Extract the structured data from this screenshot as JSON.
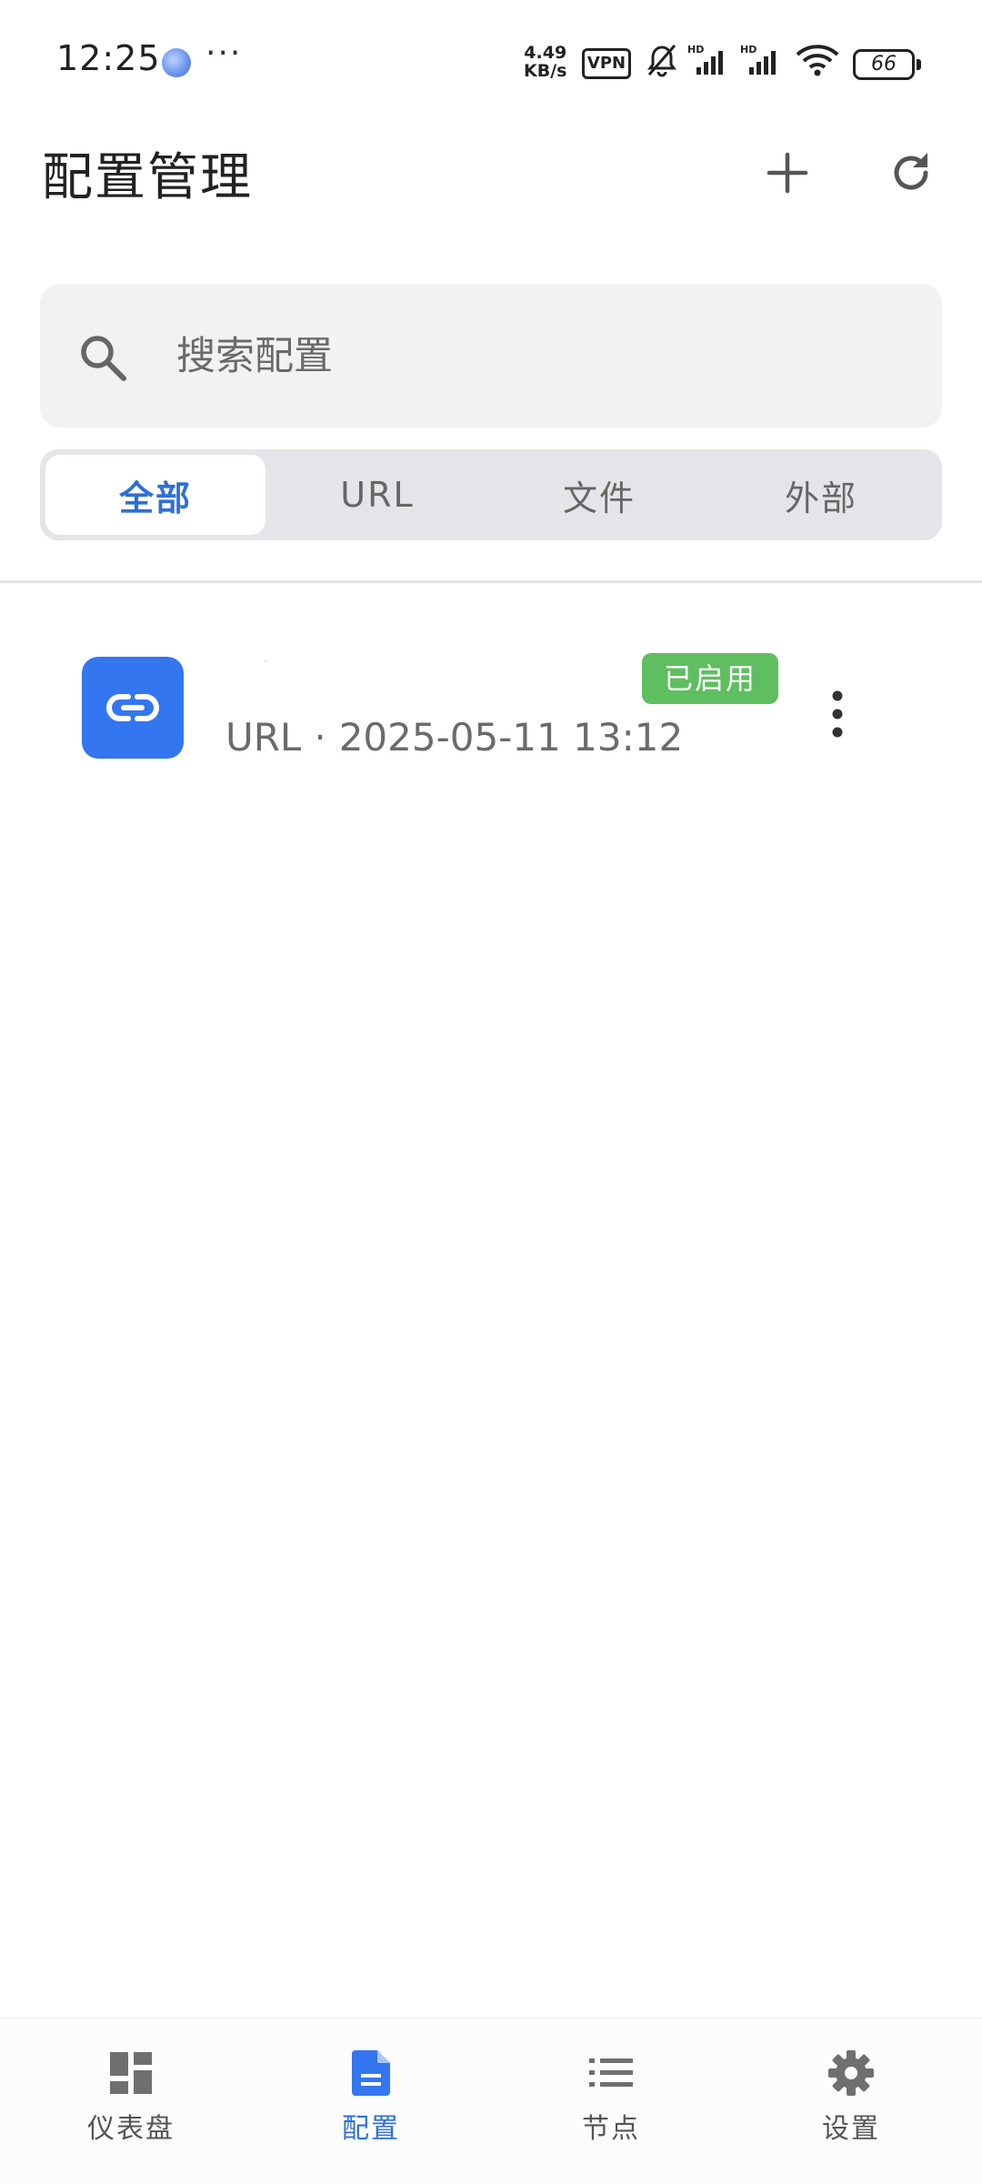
{
  "status_bar": {
    "time": "12:25",
    "more": "···",
    "speed_value": "4.49",
    "speed_unit": "KB/s",
    "vpn": "VPN",
    "battery": "66"
  },
  "header": {
    "title": "配置管理",
    "add_icon": "plus-icon",
    "refresh_icon": "refresh-icon"
  },
  "search": {
    "placeholder": "搜索配置",
    "value": ""
  },
  "tabs": [
    {
      "label": "全部",
      "active": true
    },
    {
      "label": "URL",
      "active": false
    },
    {
      "label": "文件",
      "active": false
    },
    {
      "label": "外部",
      "active": false
    }
  ],
  "configs": [
    {
      "name": "·",
      "type": "URL",
      "separator": "·",
      "date": "2025-05-11 13:12",
      "status": "已启用",
      "icon": "link-icon",
      "status_color": "#5fbe60",
      "icon_color": "#3376f0"
    }
  ],
  "bottom_nav": [
    {
      "label": "仪表盘",
      "icon": "dashboard-icon",
      "active": false
    },
    {
      "label": "配置",
      "icon": "document-icon",
      "active": true
    },
    {
      "label": "节点",
      "icon": "list-icon",
      "active": false
    },
    {
      "label": "设置",
      "icon": "gear-icon",
      "active": false
    }
  ],
  "colors": {
    "accent": "#2f6fd6",
    "badge_green": "#5fbe60"
  }
}
